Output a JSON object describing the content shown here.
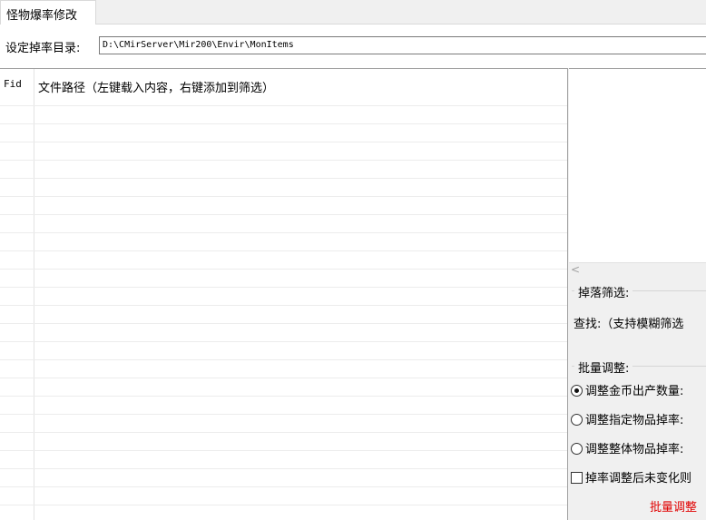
{
  "tabs": [
    {
      "label": "怪物爆率修改"
    }
  ],
  "settings": {
    "dir_label": "设定掉率目录:",
    "dir_value": "D:\\CMirServer\\Mir200\\Envir\\MonItems"
  },
  "grid": {
    "columns": [
      "Fid",
      "文件路径（左键载入内容，右键添加到筛选）"
    ],
    "rows": []
  },
  "filter": {
    "group_title": "掉落筛选:",
    "find_label": "查找:（支持模糊筛选"
  },
  "batch": {
    "group_title": "批量调整:",
    "options": [
      {
        "label": "调整金币出产数量:",
        "selected": true
      },
      {
        "label": "调整指定物品掉率:",
        "selected": false
      },
      {
        "label": "调整整体物品掉率:",
        "selected": false
      }
    ],
    "checkbox_label": "掉率调整后未变化则",
    "checked": false,
    "button_label": "批量调整",
    "button_color": "#e00000"
  }
}
